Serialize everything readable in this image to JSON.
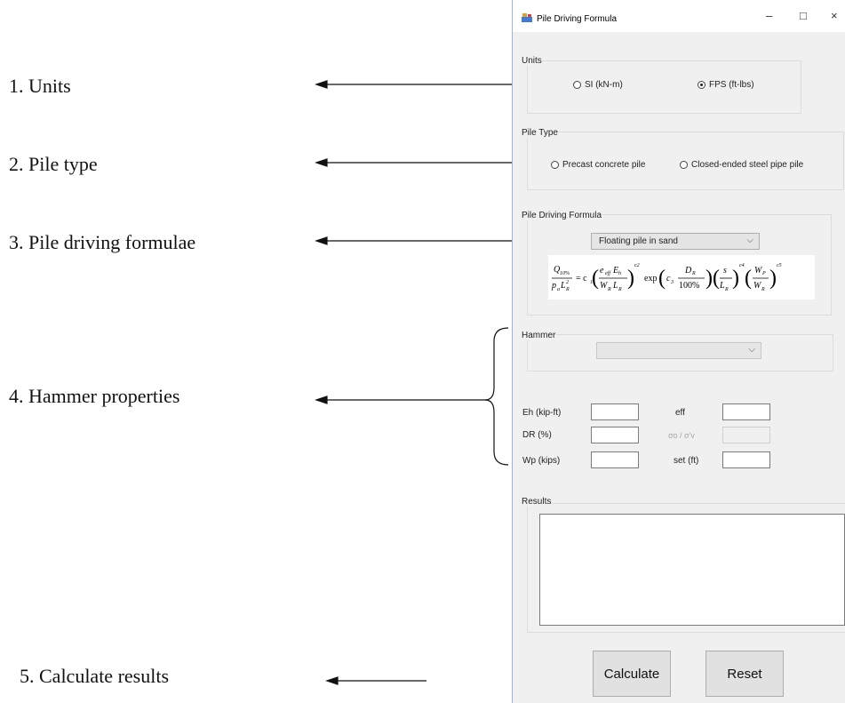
{
  "annotations": {
    "units": "1. Units",
    "pile_type": "2. Pile type",
    "formulae": "3. Pile driving formulae",
    "hammer": "4. Hammer properties",
    "calculate": "5. Calculate results"
  },
  "window": {
    "title": "Pile Driving Formula",
    "minimize": "–",
    "maximize": "□",
    "close": "×"
  },
  "units": {
    "label": "Units",
    "options": [
      {
        "label": "SI (kN-m)",
        "checked": false
      },
      {
        "label": "FPS (ft-lbs)",
        "checked": true
      }
    ]
  },
  "pile_type": {
    "label": "Pile Type",
    "options": [
      {
        "label": "Precast concrete pile",
        "checked": false
      },
      {
        "label": "Closed-ended steel pipe pile",
        "checked": false
      }
    ]
  },
  "formula": {
    "label": "Pile Driving Formula",
    "selected": "Floating pile in sand"
  },
  "hammer": {
    "label": "Hammer",
    "selected": ""
  },
  "fields": {
    "eh": "Eh (kip-ft)",
    "eff": "eff",
    "dr": "DR (%)",
    "sigma": "σo / σ'v",
    "wp": "Wp (kips)",
    "set": "set (ft)"
  },
  "results": {
    "label": "Results",
    "value": ""
  },
  "buttons": {
    "calculate": "Calculate",
    "reset": "Reset"
  }
}
